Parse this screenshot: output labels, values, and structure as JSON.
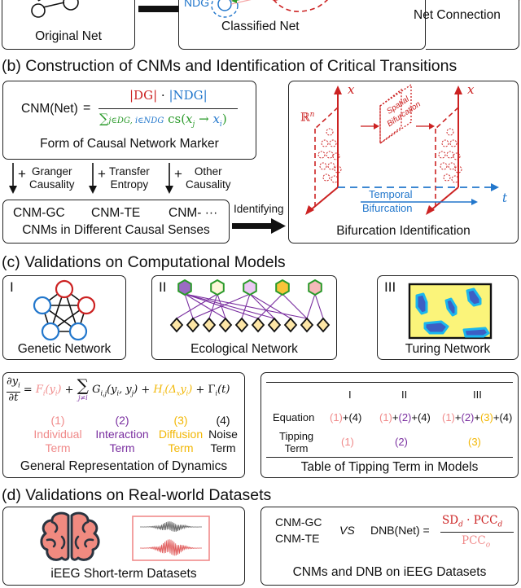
{
  "panel_a": {
    "original_net_caption": "Original Net",
    "classified_net_caption": "Classified Net",
    "ndg_label": "NDG",
    "net_connection_label": "Net Connection"
  },
  "panel_b": {
    "title": "(b) Construction of CNMs and Identification of Critical Transitions",
    "formula_lhs": "CNM(Net)",
    "equals": "=",
    "numerator": {
      "dg": "|DG|",
      "dot": "·",
      "ndg": "|NDG|"
    },
    "denominator": {
      "sum": "∑",
      "sub_dg": "j∈DG,",
      "sub_ndg": "i∈NDG",
      "cs": "cs(",
      "xj": "x",
      "xj_sub": "j",
      "arrow": "→",
      "xi": "x",
      "xi_sub": "i",
      "close": ")"
    },
    "form_caption": "Form of Causal Network Marker",
    "arrows": [
      {
        "plus": "+",
        "line1": "Granger",
        "line2": "Causality"
      },
      {
        "plus": "+",
        "line1": "Transfer",
        "line2": "Entropy"
      },
      {
        "plus": "+",
        "line1": "Other",
        "line2": "Causality"
      }
    ],
    "cnm_items": [
      "CNM-GC",
      "CNM-TE",
      "CNM- ···"
    ],
    "cnm_caption": "CNMs in Different Causal Senses",
    "identifying_label": "Identifying",
    "bifurcation": {
      "axis_x": "x",
      "axis_t": "t",
      "space_label": "ℝ",
      "space_sup": "n",
      "spatial_line1": "Spatial",
      "spatial_line2": "Bifurcation",
      "temporal_line1": "Temporal",
      "temporal_line2": "Bifurcation",
      "caption": "Bifurcation Identification"
    }
  },
  "panel_c": {
    "title": "(c) Validations on Computational Models",
    "models": [
      {
        "numeral": "I",
        "caption": "Genetic Network"
      },
      {
        "numeral": "II",
        "caption": "Ecological Network"
      },
      {
        "numeral": "III",
        "caption": "Turing Network"
      }
    ],
    "equation": {
      "lhs_num": "∂y",
      "lhs_num_sub": "i",
      "lhs_den": "∂t",
      "eq": "=",
      "term1": "F",
      "term1_rest": "(y",
      "term1_close": ")",
      "plus": "+",
      "sum": "∑",
      "sum_sub": "j≠i",
      "term2": "G",
      "term2_sub": "i,j",
      "term2_rest": "(y",
      "term2_mid": ", y",
      "term2_close": ")",
      "term3": "H",
      "term3_rest": "(Δ",
      "term3_x": "x",
      "term3_y": "y",
      "term3_close": ")",
      "term4": "Γ",
      "term4_rest": "(t)",
      "sub_i": "i"
    },
    "terms": [
      {
        "num": "(1)",
        "line1": "Individual",
        "line2": "Term",
        "color": "#f08a8a"
      },
      {
        "num": "(2)",
        "line1": "Interaction",
        "line2": "Term",
        "color": "#7a2fa0"
      },
      {
        "num": "(3)",
        "line1": "Diffusion",
        "line2": "Term",
        "color": "#f2b705"
      },
      {
        "num": "(4)",
        "line1": "Noise",
        "line2": "Term",
        "color": "#111111"
      }
    ],
    "dynamics_caption": "General Representation of Dynamics",
    "table": {
      "headers": [
        "",
        "I",
        "II",
        "III"
      ],
      "equation_label": "Equation",
      "tipping_label_1": "Tipping",
      "tipping_label_2": "Term",
      "equation_row": [
        [
          {
            "t": "(1)",
            "c": "pink"
          },
          {
            "t": "+(4)",
            "c": "black"
          }
        ],
        [
          {
            "t": "(1)",
            "c": "pink"
          },
          {
            "t": "+",
            "c": "black"
          },
          {
            "t": "(2)",
            "c": "purple"
          },
          {
            "t": "+(4)",
            "c": "black"
          }
        ],
        [
          {
            "t": "(1)",
            "c": "pink"
          },
          {
            "t": "+",
            "c": "black"
          },
          {
            "t": "(2)",
            "c": "purple"
          },
          {
            "t": "+",
            "c": "black"
          },
          {
            "t": "(3)",
            "c": "yellow"
          },
          {
            "t": "+(4)",
            "c": "black"
          }
        ]
      ],
      "tipping_row": [
        {
          "t": "(1)",
          "c": "pink"
        },
        {
          "t": "(2)",
          "c": "purple"
        },
        {
          "t": "(3)",
          "c": "yellow"
        }
      ],
      "caption": "Table of Tipping Term in Models"
    }
  },
  "panel_d": {
    "title": "(d) Validations on Real-world Datasets",
    "ieeg_caption": "iEEG Short-term Datasets",
    "cnm_gc": "CNM-GC",
    "cnm_te": "CNM-TE",
    "vs": "VS",
    "dnb_lhs": "DNB(Net) =",
    "dnb_num_sd": "SD",
    "dnb_num_d": "d",
    "dnb_num_dot": " · PCC",
    "dnb_num_d2": "d",
    "dnb_den": "PCC",
    "dnb_den_sub": "o",
    "dnb_caption": "CNMs and DNB on iEEG Datasets"
  },
  "colors": {
    "red": "#cc2222",
    "blue": "#2277cc",
    "green": "#2a9a2a",
    "pink": "#f08a8a",
    "purple": "#7a2fa0",
    "yellow": "#f2b705",
    "brain_fill": "#f08a80",
    "brain_stroke": "#2a3440",
    "turing_bg": "#fbf47a",
    "turing_spot": "#3c5fc4",
    "turing_halo": "#1bb7ee"
  }
}
